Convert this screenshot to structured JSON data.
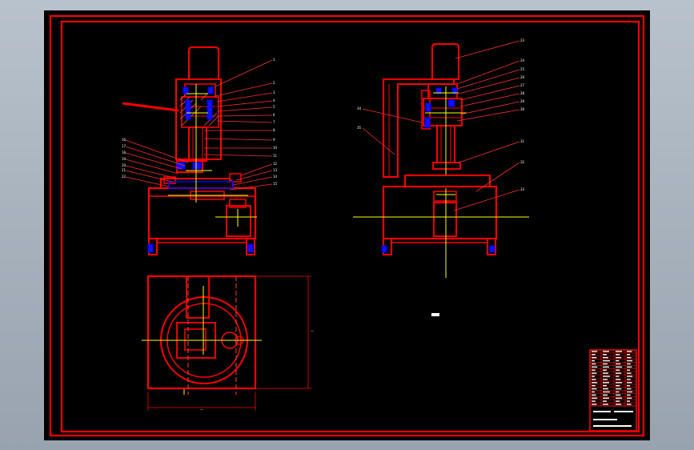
{
  "drawing": {
    "background": "#000000",
    "frame_color": "#ff0000",
    "centerline_color": "#ffff00",
    "hidden_color": "#ff4040",
    "part_color": "#0000ff",
    "leader_color": "#ff2020",
    "text_color": "#ffffff"
  },
  "views": [
    {
      "id": "front",
      "name": "front-view"
    },
    {
      "id": "side",
      "name": "side-view"
    },
    {
      "id": "top",
      "name": "top-view"
    }
  ],
  "title_block": {
    "rows": 18
  }
}
